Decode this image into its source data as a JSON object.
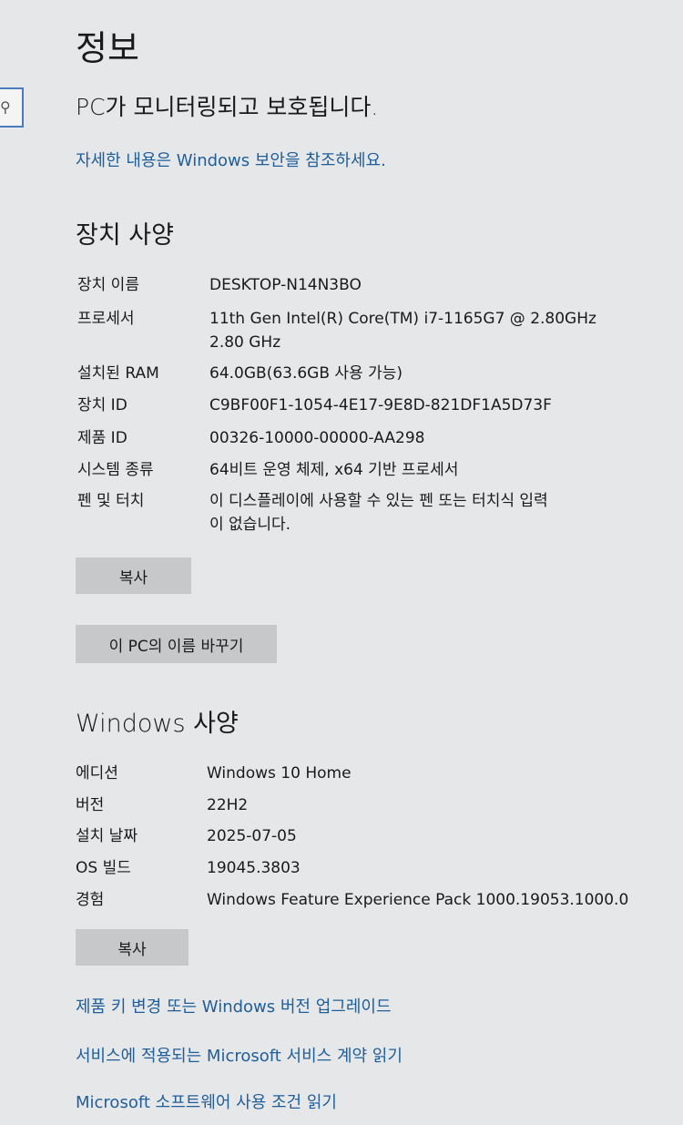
{
  "header": {
    "title": "정보",
    "status": "PC가 모니터링되고 보호됩니다.",
    "security_link": "자세한 내용은 Windows 보안을 참조하세요."
  },
  "device_specs": {
    "title": "장치 사양",
    "rows": [
      {
        "label": "장치 이름",
        "value": "DESKTOP-N14N3BO",
        "value2": ""
      },
      {
        "label": "프로세서",
        "value": "11th Gen Intel(R) Core(TM) i7-1165G7 @ 2.80GHz",
        "value2": "2.80 GHz"
      },
      {
        "label": "설치된 RAM",
        "value": "64.0GB(63.6GB 사용 가능)",
        "value2": ""
      },
      {
        "label": "장치 ID",
        "value": "C9BF00F1-1054-4E17-9E8D-821DF1A5D73F",
        "value2": ""
      },
      {
        "label": "제품 ID",
        "value": "00326-10000-00000-AA298",
        "value2": ""
      },
      {
        "label": "시스템 종류",
        "value": "64비트 운영 체제, x64 기반 프로세서",
        "value2": ""
      },
      {
        "label": "펜 및 터치",
        "value": "이 디스플레이에 사용할 수 있는 펜 또는 터치식 입력",
        "value2": "이 없습니다."
      }
    ],
    "copy_button": "복사",
    "rename_button": "이 PC의 이름 바꾸기"
  },
  "windows_specs": {
    "title": "Windows 사양",
    "rows": [
      {
        "label": "에디션",
        "value": "Windows 10 Home"
      },
      {
        "label": "버전",
        "value": "22H2"
      },
      {
        "label": "설치 날짜",
        "value": "2025-07-05"
      },
      {
        "label": "OS 빌드",
        "value": "19045.3803"
      },
      {
        "label": "경험",
        "value": "Windows Feature Experience Pack 1000.19053.1000.0"
      }
    ],
    "copy_button": "복사"
  },
  "links": [
    "제품 키 변경 또는 Windows 버전 업그레이드",
    "서비스에 적용되는 Microsoft 서비스 계약 읽기",
    "Microsoft 소프트웨어 사용 조건 읽기"
  ],
  "icons": {
    "search": "search-icon"
  },
  "colors": {
    "background": "#e6e7e9",
    "link": "#1f5e99",
    "button": "#c7c8ca"
  }
}
